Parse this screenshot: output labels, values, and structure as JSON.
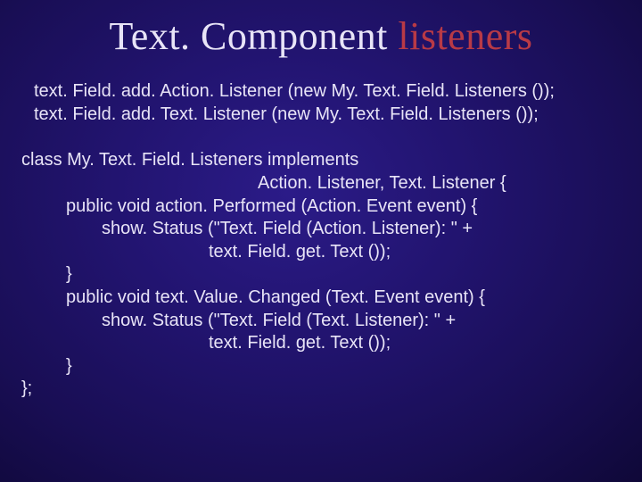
{
  "title_word1": "Text. Component",
  "title_word2": "listeners",
  "block1": {
    "l1": "text. Field. add. Action. Listener (new My. Text. Field. Listeners ());",
    "l2": "text. Field. add. Text. Listener (new My. Text. Field. Listeners ());"
  },
  "block2": {
    "l1": "class My. Text. Field. Listeners implements",
    "l2": "Action. Listener, Text. Listener {",
    "l3": "public void action. Performed (Action. Event event) {",
    "l4": "show. Status (\"Text. Field (Action. Listener): \" +",
    "l5": "text. Field. get. Text ());",
    "l6": "}",
    "l7": "public void text. Value. Changed (Text. Event event) {",
    "l8": "show. Status (\"Text. Field (Text. Listener): \" +",
    "l9": "text. Field. get. Text ());",
    "l10": "}",
    "l11": "};"
  }
}
